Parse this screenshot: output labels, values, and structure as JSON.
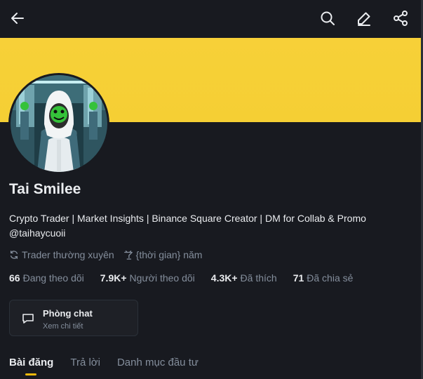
{
  "topbar": {
    "back_icon": "arrow-left-icon",
    "search_icon": "search-icon",
    "edit_icon": "pencil-icon",
    "share_icon": "share-icon"
  },
  "banner": {
    "color": "#f5cf34"
  },
  "profile": {
    "name": "Tai Smilee",
    "bio_line1": "Crypto Trader | Market Insights | Binance Square Creator | DM for Collab & Promo",
    "bio_line2": "@taihaycuoii",
    "trader_label": "Trader thường xuyên",
    "trader_icon": "refresh-icon",
    "time_label": "{thời gian} năm",
    "time_icon": "cake-icon"
  },
  "stats": [
    {
      "value": "66",
      "label": "Đang theo dõi"
    },
    {
      "value": "7.9K+",
      "label": "Người theo dõi"
    },
    {
      "value": "4.3K+",
      "label": "Đã thích"
    },
    {
      "value": "71",
      "label": "Đã chia sẻ"
    }
  ],
  "chat_card": {
    "title": "Phòng chat",
    "subtitle": "Xem chi tiết",
    "icon": "chat-bubble-icon"
  },
  "tabs": [
    {
      "label": "Bài đăng",
      "active": true
    },
    {
      "label": "Trả lời",
      "active": false
    },
    {
      "label": "Danh mục đầu tư",
      "active": false
    }
  ],
  "colors": {
    "background": "#181a20",
    "accent": "#f0b90b",
    "text_primary": "#eaecef",
    "text_secondary": "#848e9c"
  }
}
